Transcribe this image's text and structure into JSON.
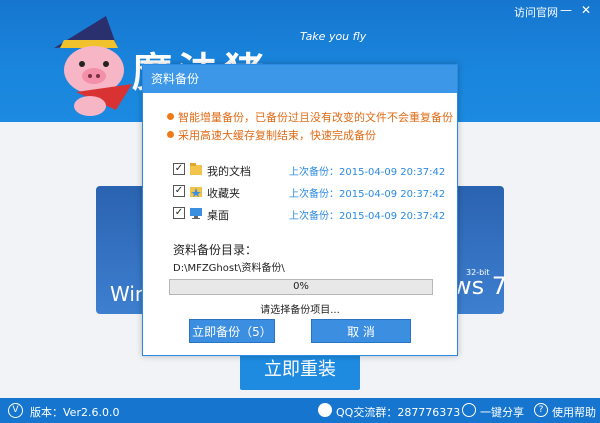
{
  "header": {
    "visit_link": "访问官网",
    "min_glyph": "—",
    "close_glyph": "✕",
    "logo": "魔法猪",
    "slogan": "Take you fly"
  },
  "main": {
    "left_card_text": "Win",
    "right_card_text": "ws 7",
    "right_card_bit": "32-bit",
    "reinstall_label": "立即重装"
  },
  "footer": {
    "version_label": "版本：Ver2.6.0.0",
    "qq_group": "QQ交流群：287776373",
    "share_label": "一键分享",
    "help_label": "使用帮助"
  },
  "dialog": {
    "title": "资料备份",
    "notices": [
      "智能增量备份，已备份过且没有改变的文件不会重复备份",
      "采用高速大缓存复制结束，快速完成备份"
    ],
    "items": [
      {
        "checked": true,
        "name": "我的文档",
        "time": "上次备份：2015-04-09 20:37:42",
        "icon": "documents-icon"
      },
      {
        "checked": true,
        "name": "收藏夹",
        "time": "上次备份：2015-04-09 20:37:42",
        "icon": "favorites-icon"
      },
      {
        "checked": true,
        "name": "桌面",
        "time": "上次备份：2015-04-09 20:37:42",
        "icon": "desktop-icon"
      }
    ],
    "dir_label": "资料备份目录：",
    "dir_path": "D:\\MFZGhost\\资料备份\\",
    "progress_percent": 0,
    "progress_text": "0%",
    "status_text": "请选择备份项目...",
    "backup_button": "立即备份（5）",
    "cancel_button": "取 消",
    "check_glyph": "✓"
  },
  "colors": {
    "header_blue": "#1676cf",
    "dialog_title_blue": "#3c97e8",
    "notice_orange": "#e06b16",
    "time_blue": "#2b8be2"
  }
}
